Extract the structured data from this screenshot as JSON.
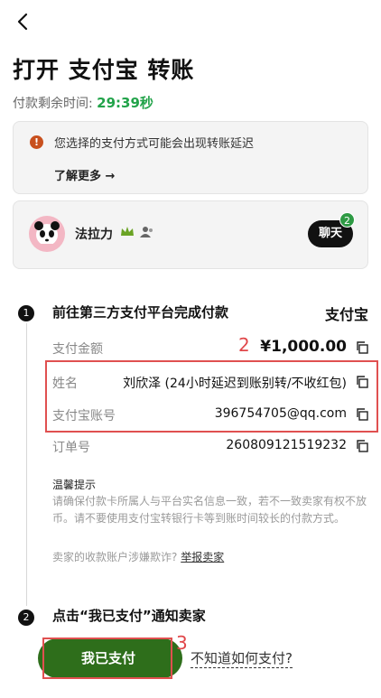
{
  "header": {
    "title": "打开 支付宝 转账",
    "timer_label": "付款剩余时间:",
    "timer_value": "29:39秒"
  },
  "notice": {
    "icon": "warning-icon",
    "message": "您选择的支付方式可能会出现转账延迟",
    "learn_more": "了解更多 →"
  },
  "seller": {
    "name": "法拉力",
    "chat_label": "聊天",
    "chat_badge": "2"
  },
  "step1": {
    "number": "1",
    "title": "前往第三方支付平台完成付款",
    "method": "支付宝",
    "rows": [
      {
        "label": "支付金额",
        "value": "¥1,000.00"
      },
      {
        "label": "姓名",
        "value": "刘欣泽 (24小时延迟到账别转/不收红包)"
      },
      {
        "label": "支付宝账号",
        "value": "396754705@qq.com"
      },
      {
        "label": "订单号",
        "value": "260809121519232"
      }
    ],
    "tips_title": "温馨提示",
    "tips_text": "请确保付款卡所属人与平台实名信息一致，若不一致卖家有权不放币。请不要使用支付宝转银行卡等到账时间较长的付款方式。",
    "fraud_text": "卖家的收款账户涉嫌欺诈?",
    "report_link": "举报卖家"
  },
  "step2": {
    "number": "2",
    "title": "点击“我已支付”通知卖家",
    "paid_button": "我已支付",
    "how_link": "不知道如何支付?"
  },
  "annotations": {
    "a2": "2",
    "a3": "3"
  },
  "colors": {
    "timer": "#22a34a",
    "primary_button": "#2e6e1b",
    "highlight": "#e05050"
  }
}
